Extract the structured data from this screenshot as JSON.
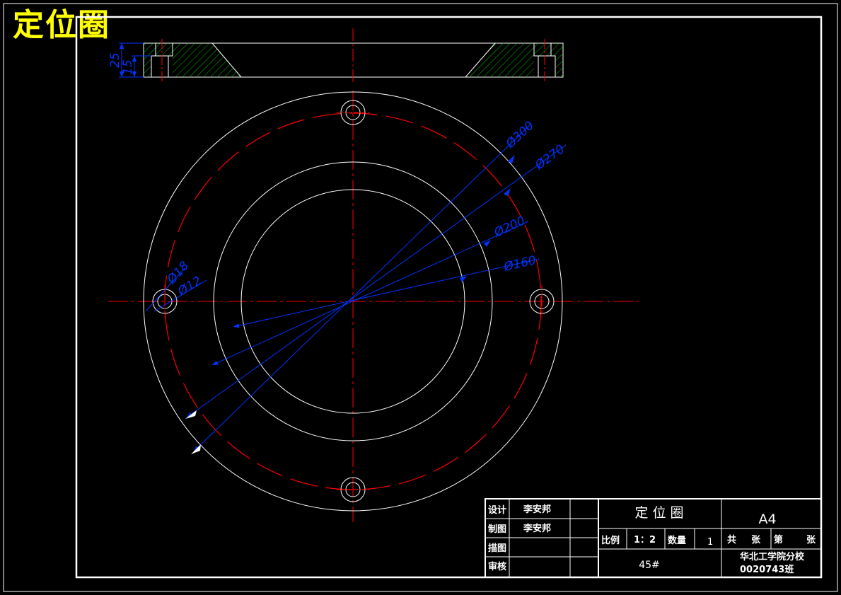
{
  "drawing_title": "定位圈",
  "dimensions": {
    "d300": "Ø300",
    "d270": "Ø270",
    "d200": "Ø200",
    "d160": "Ø160",
    "d18": "Ø18",
    "d12": "Ø12",
    "h25": "25",
    "h15": "15"
  },
  "title_block": {
    "design_label": "设计",
    "design_name": "李安邦",
    "drawn_label": "制图",
    "drawn_name": "李安邦",
    "trace_label": "描图",
    "review_label": "审核",
    "part_name": "定 位 圈",
    "sheet_size": "A4",
    "scale_label": "比例",
    "scale_value": "1：2",
    "qty_label": "数量",
    "qty_value": "1",
    "total_label": "共",
    "sheet_unit_1": "张",
    "page_label": "第",
    "sheet_unit_2": "张",
    "material": "45#",
    "school": "华北工学院分校",
    "class": "0020743班"
  },
  "colors": {
    "outline": "#ffffff",
    "centerline": "#ff0000",
    "dimension": "#0033ff",
    "hatch": "#00c000",
    "title": "#ffff00"
  }
}
